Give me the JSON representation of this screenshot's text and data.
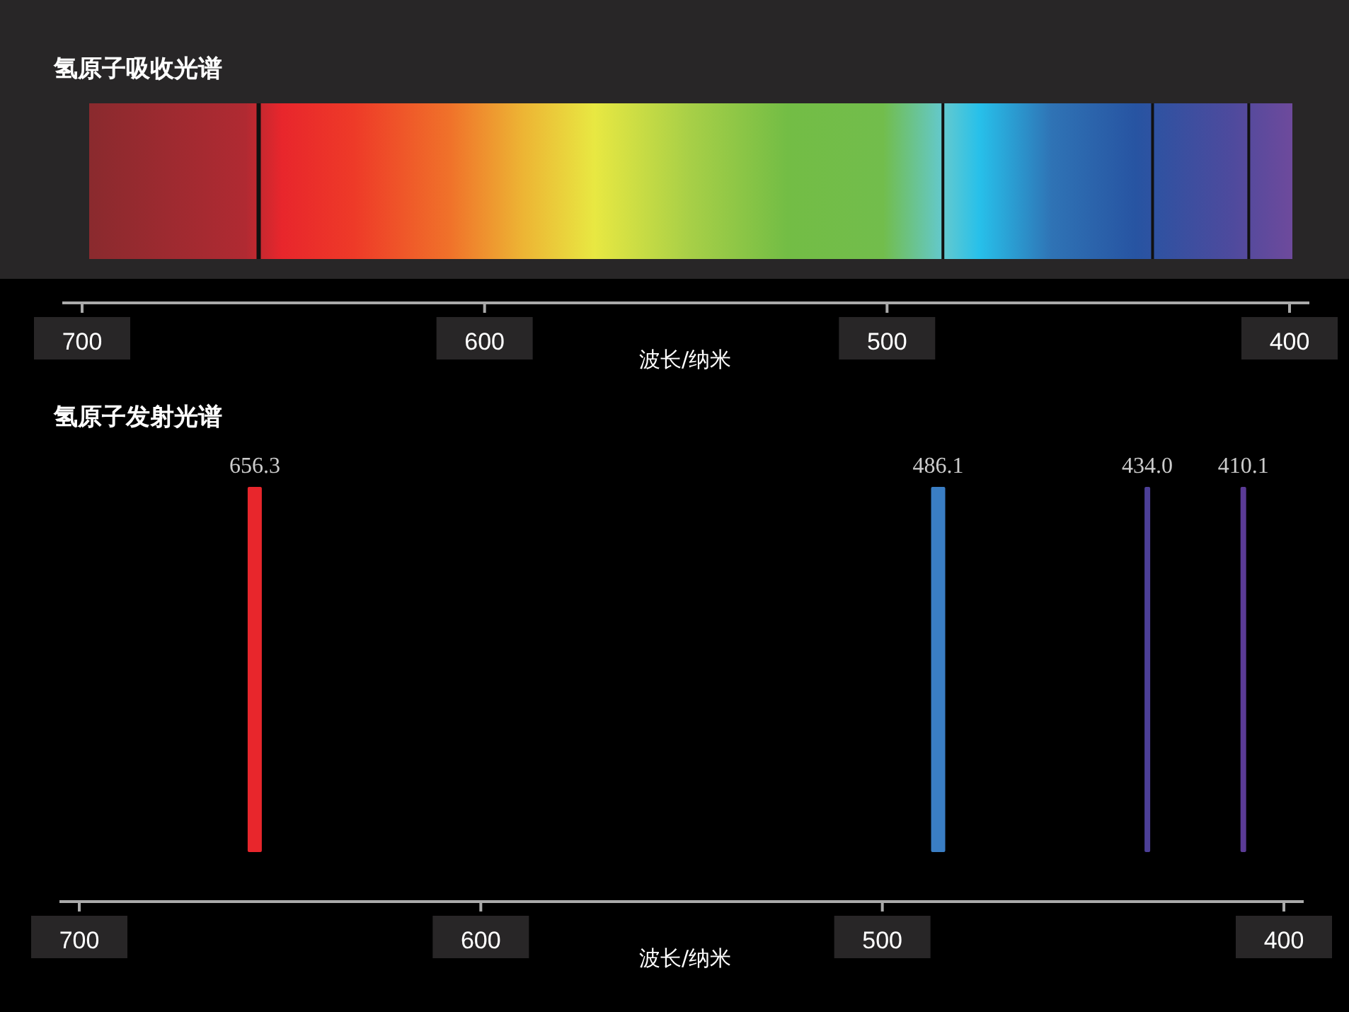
{
  "absorption": {
    "title": "氢原子吸收光谱",
    "axis": {
      "ticks": [
        "700",
        "600",
        "500",
        "400"
      ],
      "label": "波长/纳米"
    }
  },
  "emission": {
    "title": "氢原子发射光谱",
    "lines": [
      {
        "label": "656.3",
        "color": "#e8262c"
      },
      {
        "label": "486.1",
        "color": "#3a7ec4"
      },
      {
        "label": "434.0",
        "color": "#4c3f97"
      },
      {
        "label": "410.1",
        "color": "#5b3b96"
      }
    ],
    "axis": {
      "ticks": [
        "700",
        "600",
        "500",
        "400"
      ],
      "label": "波长/纳米"
    }
  }
}
